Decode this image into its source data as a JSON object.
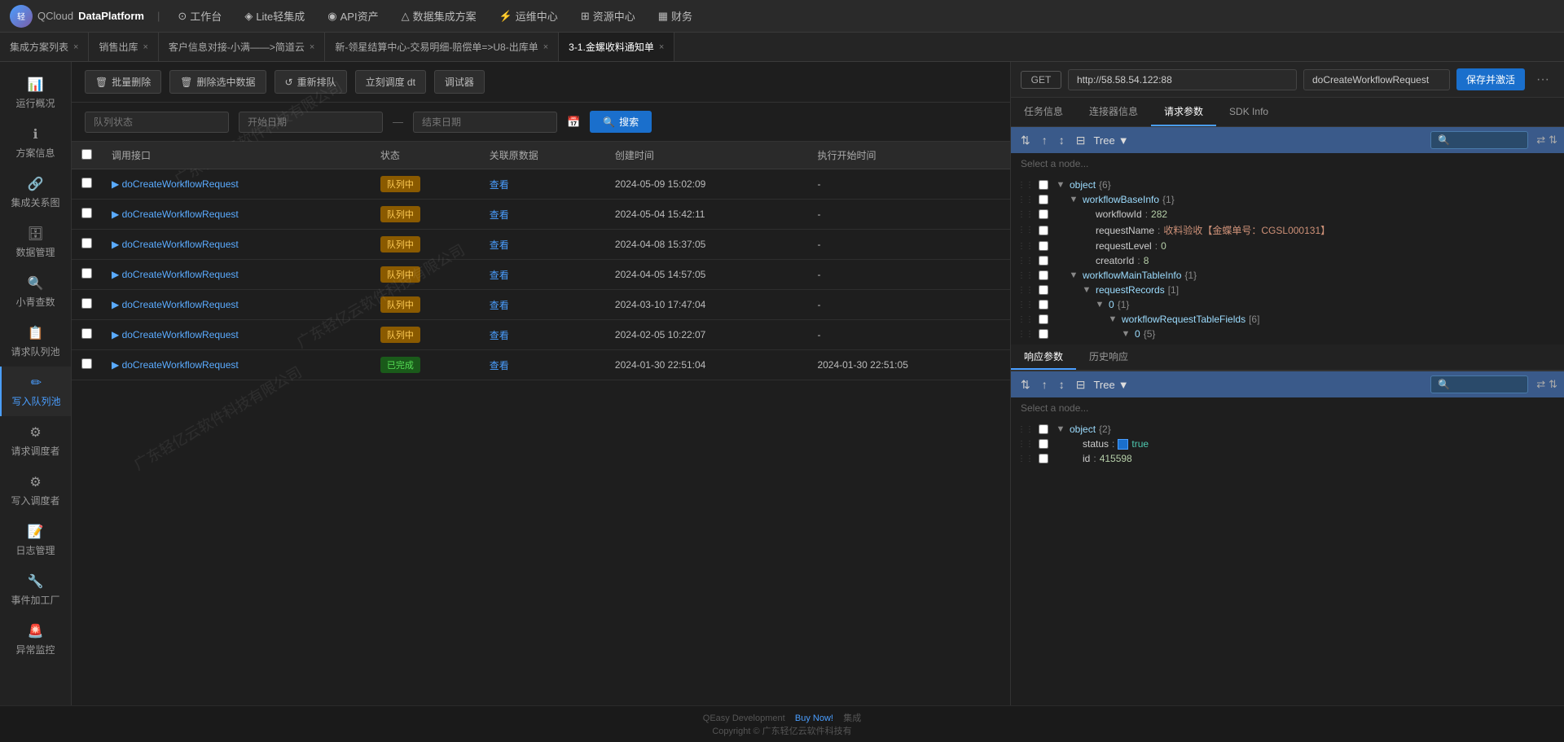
{
  "app": {
    "logo_text": "QCloud",
    "title": "DataPlatform"
  },
  "top_nav": {
    "items": [
      {
        "label": "工作台",
        "icon": "⊙"
      },
      {
        "label": "Lite轻集成",
        "icon": "◈"
      },
      {
        "label": "API资产",
        "icon": "◉"
      },
      {
        "label": "数据集成方案",
        "icon": "△"
      },
      {
        "label": "运维中心",
        "icon": "⚡"
      },
      {
        "label": "资源中心",
        "icon": "⊞"
      },
      {
        "label": "财务",
        "icon": "▦"
      }
    ]
  },
  "tabs": [
    {
      "label": "集成方案列表",
      "active": false,
      "closable": true
    },
    {
      "label": "销售出库",
      "active": false,
      "closable": true
    },
    {
      "label": "客户信息对接-小满——>简道云",
      "active": false,
      "closable": true
    },
    {
      "label": "新-领星结算中心-交易明细-赔偿单=>U8-出库单",
      "active": false,
      "closable": true
    },
    {
      "label": "3-1.金螺收料通知单",
      "active": true,
      "closable": true
    }
  ],
  "sidebar": {
    "items": [
      {
        "label": "运行概况",
        "icon": "📊"
      },
      {
        "label": "方案信息",
        "icon": "ℹ"
      },
      {
        "label": "集成关系图",
        "icon": "🔗"
      },
      {
        "label": "数据管理",
        "icon": "🗄"
      },
      {
        "label": "小青查数",
        "icon": "🔍"
      },
      {
        "label": "请求队列池",
        "icon": "📋"
      },
      {
        "label": "写入队列池",
        "icon": "✏",
        "active": true
      },
      {
        "label": "请求调度者",
        "icon": "⚙"
      },
      {
        "label": "写入调度者",
        "icon": "⚙"
      },
      {
        "label": "日志管理",
        "icon": "📝"
      },
      {
        "label": "事件加工厂",
        "icon": "🔧"
      },
      {
        "label": "异常监控",
        "icon": "🚨"
      }
    ]
  },
  "toolbar": {
    "batch_delete": "批量删除",
    "delete_selected": "删除选中数据",
    "requeue": "重新排队",
    "schedule_dt": "立刻调度 dt",
    "debug": "调试器"
  },
  "filter": {
    "queue_status_placeholder": "队列状态",
    "start_date_placeholder": "开始日期",
    "end_date_placeholder": "结束日期",
    "search_label": "搜索"
  },
  "table": {
    "columns": [
      "",
      "调用接口",
      "状态",
      "关联原数据",
      "创建时间",
      "执行开始时间"
    ],
    "rows": [
      {
        "iface": "doCreateWorkflowRequest",
        "status": "队列中",
        "status_type": "queue",
        "related": "查看",
        "created": "2024-05-09 15:02:09",
        "exec_start": "-"
      },
      {
        "iface": "doCreateWorkflowRequest",
        "status": "队列中",
        "status_type": "queue",
        "related": "查看",
        "created": "2024-05-04 15:42:11",
        "exec_start": "-"
      },
      {
        "iface": "doCreateWorkflowRequest",
        "status": "队列中",
        "status_type": "queue",
        "related": "查看",
        "created": "2024-04-08 15:37:05",
        "exec_start": "-"
      },
      {
        "iface": "doCreateWorkflowRequest",
        "status": "队列中",
        "status_type": "queue",
        "related": "查看",
        "created": "2024-04-05 14:57:05",
        "exec_start": "-"
      },
      {
        "iface": "doCreateWorkflowRequest",
        "status": "队列中",
        "status_type": "queue",
        "related": "查看",
        "created": "2024-03-10 17:47:04",
        "exec_start": "-"
      },
      {
        "iface": "doCreateWorkflowRequest",
        "status": "队列中",
        "status_type": "queue",
        "related": "查看",
        "created": "2024-02-05 10:22:07",
        "exec_start": "-"
      },
      {
        "iface": "doCreateWorkflowRequest",
        "status": "已完成",
        "status_type": "done",
        "related": "查看",
        "created": "2024-01-30 22:51:04",
        "exec_start": "2024-01-30 22:51:05"
      }
    ]
  },
  "right_panel": {
    "method": "GET",
    "url": "http://58.58.54.122:88",
    "endpoint": "doCreateWorkflowRequest",
    "save_btn": "保存并激活",
    "more_btn": "···",
    "tabs": [
      {
        "label": "任务信息"
      },
      {
        "label": "连接器信息"
      },
      {
        "label": "请求参数",
        "active": true
      },
      {
        "label": "SDK Info"
      }
    ],
    "request_tree": {
      "toolbar_label": "Tree",
      "placeholder": "Select a node...",
      "nodes": [
        {
          "indent": 0,
          "arrow": "▼",
          "key": "object",
          "brace": "{6}",
          "depth": 0
        },
        {
          "indent": 1,
          "arrow": "▼",
          "key": "workflowBaseInfo",
          "brace": "{1}",
          "depth": 1
        },
        {
          "indent": 2,
          "arrow": "",
          "key": "workflowId",
          "sep": ":",
          "value": "282",
          "type": "number",
          "depth": 2
        },
        {
          "indent": 2,
          "arrow": "",
          "key": "requestName",
          "sep": ":",
          "value": "收料验收【金蝶单号：CGSL000131】",
          "type": "string",
          "depth": 2
        },
        {
          "indent": 2,
          "arrow": "",
          "key": "requestLevel",
          "sep": ":",
          "value": "0",
          "type": "number",
          "depth": 2
        },
        {
          "indent": 2,
          "arrow": "",
          "key": "creatorId",
          "sep": ":",
          "value": "8",
          "type": "number",
          "depth": 2
        },
        {
          "indent": 1,
          "arrow": "▼",
          "key": "workflowMainTableInfo",
          "brace": "{1}",
          "depth": 1
        },
        {
          "indent": 2,
          "arrow": "▼",
          "key": "requestRecords",
          "brace": "[1]",
          "depth": 2
        },
        {
          "indent": 3,
          "arrow": "▼",
          "key": "0",
          "brace": "{1}",
          "depth": 3
        },
        {
          "indent": 4,
          "arrow": "▼",
          "key": "workflowRequestTableFields",
          "brace": "[6]",
          "depth": 4
        },
        {
          "indent": 5,
          "arrow": "▼",
          "key": "0",
          "brace": "{5}",
          "depth": 5
        }
      ]
    },
    "response_tabs": [
      {
        "label": "响应参数",
        "active": true
      },
      {
        "label": "历史响应"
      }
    ],
    "response_tree": {
      "toolbar_label": "Tree",
      "placeholder": "Select a node...",
      "nodes": [
        {
          "indent": 0,
          "arrow": "▼",
          "key": "object",
          "brace": "{2}",
          "depth": 0
        },
        {
          "indent": 1,
          "arrow": "",
          "key": "status",
          "sep": ":",
          "value": "true",
          "type": "bool",
          "depth": 1
        },
        {
          "indent": 1,
          "arrow": "",
          "key": "id",
          "sep": ":",
          "value": "415598",
          "type": "number",
          "depth": 1
        }
      ]
    }
  },
  "footer": {
    "text1": "QEasy Development",
    "text2": "Buy Now!",
    "text3": "集成",
    "copyright": "Copyright © 广东轻亿云软件科技有"
  },
  "watermark": "广东轻亿云软件科技有限公司"
}
